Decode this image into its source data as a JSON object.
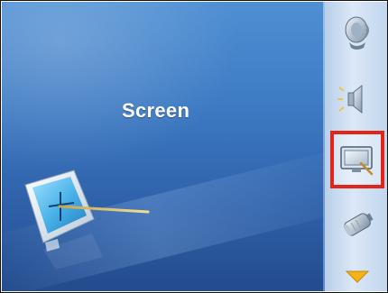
{
  "screen": {
    "title": "Screen"
  },
  "sidebar": {
    "items": [
      {
        "name": "speaker-icon",
        "selected": false
      },
      {
        "name": "volume-icon",
        "selected": false
      },
      {
        "name": "screen-icon",
        "selected": true
      },
      {
        "name": "battery-icon",
        "selected": false
      }
    ],
    "scroll": "scroll-down-arrow-icon"
  },
  "colors": {
    "selection_border": "#e1251b",
    "panel_top": "#4f8fd3",
    "panel_bottom": "#234b8d",
    "arrow": "#f2b418"
  }
}
